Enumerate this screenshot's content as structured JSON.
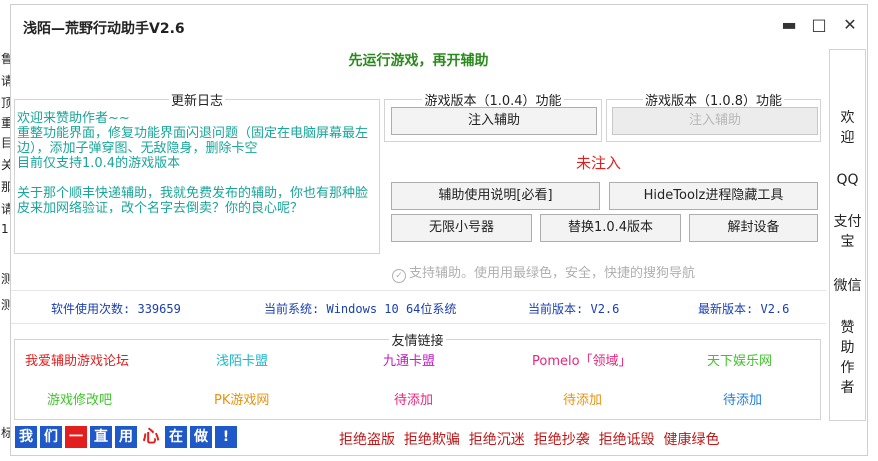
{
  "window": {
    "title": "浅陌—荒野行动助手V2.6",
    "minimize": "▬",
    "maximize": "□",
    "close": "✕"
  },
  "notice": "先运行游戏，再开辅助",
  "changelog": {
    "legend": "更新日志",
    "text": "欢迎来赞助作者~~\n重整功能界面，修复功能界面闪退问题（固定在电脑屏幕最左边），添加子弹穿图、无敌隐身，删除卡空\n目前仅支持1.0.4的游戏版本\n\n关于那个顺丰快递辅助，我就免费发布的辅助，你也有那种脸皮来加网络验证，改个名字去倒卖？你的良心呢？"
  },
  "v104": {
    "legend": "游戏版本（1.0.4）功能",
    "inject": "注入辅助"
  },
  "v108": {
    "legend": "游戏版本（1.0.8）功能",
    "inject": "注入辅助"
  },
  "status": "未注入",
  "buttons": {
    "manual": "辅助使用说明[必看]",
    "hidetool": "HideToolz进程隐藏工具",
    "unlimited": "无限小号器",
    "replace": "替换1.0.4版本",
    "unseal": "解封设备"
  },
  "support_check": "支持辅助。使用用最绿色，安全，快捷的搜狗导航",
  "stats": {
    "usage_label": "软件使用次数:",
    "usage_value": "339659",
    "system_label": "当前系统:",
    "system_value": "Windows 10  64位系统",
    "version_label": "当前版本:",
    "version_value": "V2.6",
    "latest_label": "最新版本:",
    "latest_value": "V2.6"
  },
  "friends": {
    "legend": "友情链接",
    "links": [
      {
        "text": "我爱辅助游戏论坛",
        "color": "#e02020"
      },
      {
        "text": "浅陌卡盟",
        "color": "#19b7c9"
      },
      {
        "text": "九通卡盟",
        "color": "#c619c6"
      },
      {
        "text": "Pomelo「领域」",
        "color": "#e8257a"
      },
      {
        "text": "天下娱乐网",
        "color": "#3ec429"
      },
      {
        "text": "游戏修改吧",
        "color": "#3ec429"
      },
      {
        "text": "PK游戏网",
        "color": "#e8930e"
      },
      {
        "text": "待添加",
        "color": "#e8257a"
      },
      {
        "text": "待添加",
        "color": "#e8930e"
      },
      {
        "text": "待添加",
        "color": "#1f7fd6"
      }
    ]
  },
  "sidebar": {
    "welcome": "欢\n迎",
    "qq": "QQ",
    "alipay": "支付\n宝",
    "wechat": "微信",
    "sponsor": "赞\n助\n作\n者"
  },
  "banner": [
    "我",
    "们",
    "一",
    "直",
    "用",
    "心",
    "在",
    "做",
    "!"
  ],
  "slogan": "拒绝盗版  拒绝欺骗  拒绝沉迷  拒绝抄袭  拒绝诋毁  健康绿色",
  "edge_text": [
    "鲁",
    "请",
    "顶",
    "重",
    "目",
    "关",
    "那",
    "请",
    "1",
    "测",
    "测",
    "标"
  ]
}
